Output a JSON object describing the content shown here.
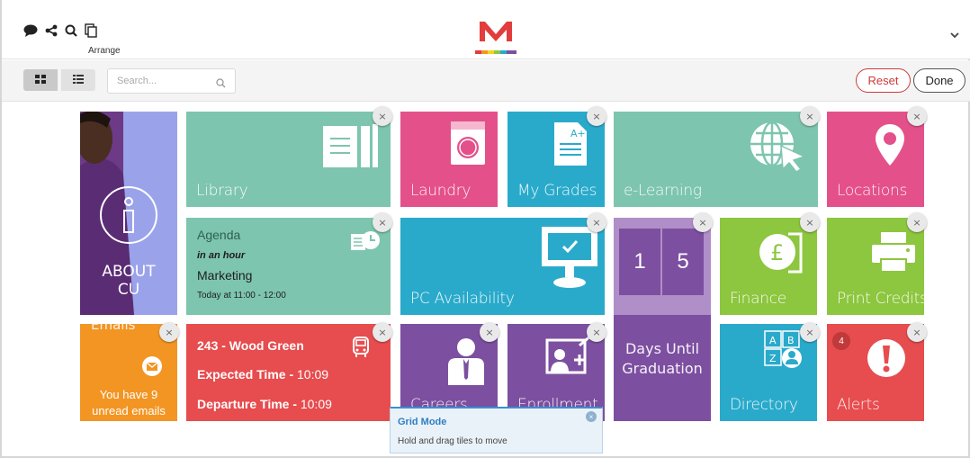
{
  "header": {
    "arrange_label": "Arrange",
    "icons": [
      "chat-icon",
      "share-icon",
      "search-icon",
      "arrange-icon"
    ],
    "logo_letter": "M"
  },
  "toolbar": {
    "search_placeholder": "Search...",
    "reset_label": "Reset",
    "done_label": "Done"
  },
  "tiles": {
    "about": {
      "label": "ABOUT\nCU",
      "label_line1": "ABOUT",
      "label_line2": "CU"
    },
    "library": {
      "label": "Library"
    },
    "laundry": {
      "label": "Laundry"
    },
    "grades": {
      "label": "My Grades"
    },
    "elearning": {
      "label": "e-Learning"
    },
    "locations": {
      "label": "Locations"
    },
    "agenda": {
      "title": "Agenda",
      "when": "in an hour",
      "event": "Marketing",
      "time": "Today at 11:00 - 12:00"
    },
    "pc": {
      "label": "PC Availability"
    },
    "countdown": {
      "digit1": "1",
      "digit2": "5",
      "label_line1": "Days Until",
      "label_line2": "Graduation"
    },
    "finance": {
      "label": "Finance"
    },
    "print": {
      "label": "Print Credits"
    },
    "emails": {
      "title": "Emails",
      "line1": "You have 9",
      "line2": "unread emails"
    },
    "bus": {
      "route": "243 - Wood Green",
      "expected_label": "Expected Time -",
      "expected_time": "10:09",
      "departure_label": "Departure Time -",
      "departure_time": "10:09"
    },
    "careers": {
      "label": "Careers"
    },
    "enrollment": {
      "label": "Enrollment"
    },
    "directory": {
      "label": "Directory"
    },
    "alerts": {
      "label": "Alerts",
      "badge": "4"
    }
  },
  "close_glyph": "×",
  "tooltip": {
    "title": "Grid Mode",
    "body": "Hold and drag tiles to move"
  },
  "colors": {
    "teal": "#7dc5ae",
    "pink": "#e4508a",
    "blue": "#2aaacb",
    "purple": "#7c4fa0",
    "green": "#8dc63f",
    "orange": "#f39523",
    "red": "#e74c4e",
    "about_bg": "#9aa3ea",
    "reset": "#d0383b"
  }
}
